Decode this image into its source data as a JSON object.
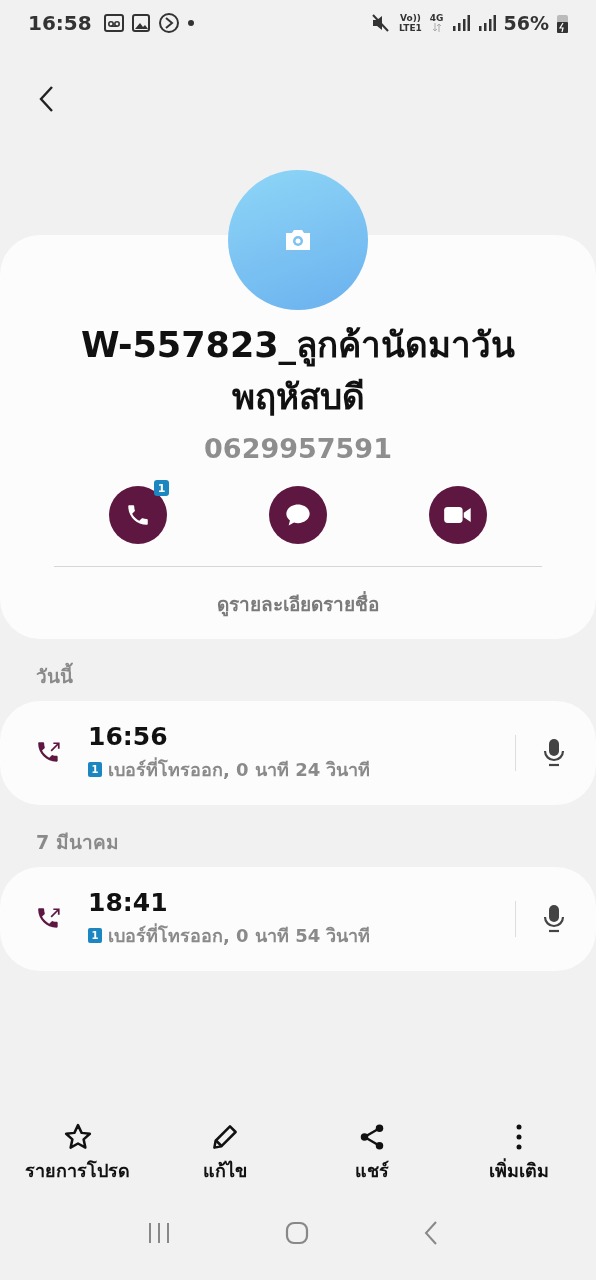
{
  "status_bar": {
    "time": "16:58",
    "volte": "Vo))",
    "lte": "LTE1",
    "network": "4G",
    "battery": "56%"
  },
  "contact": {
    "name": "W-557823_ลูกค้านัดมาวันพฤหัสบดี",
    "number": "0629957591",
    "details_link": "ดูรายละเอียดรายชื่อ"
  },
  "actions": [
    {
      "kind": "call",
      "badge": "1"
    },
    {
      "kind": "message"
    },
    {
      "kind": "video"
    }
  ],
  "history": [
    {
      "date": "วันนี้",
      "calls": [
        {
          "time": "16:56",
          "sim": "1",
          "description": "เบอร์ที่โทรออก, 0 นาที 24 วินาที"
        }
      ]
    },
    {
      "date": "7 มีนาคม",
      "calls": [
        {
          "time": "18:41",
          "sim": "1",
          "description": "เบอร์ที่โทรออก, 0 นาที 54 วินาที"
        }
      ]
    }
  ],
  "bottom_bar": [
    {
      "kind": "favourite",
      "label": "รายการโปรด"
    },
    {
      "kind": "edit",
      "label": "แก้ไข"
    },
    {
      "kind": "share",
      "label": "แชร์"
    },
    {
      "kind": "more",
      "label": "เพิ่มเติม"
    }
  ]
}
